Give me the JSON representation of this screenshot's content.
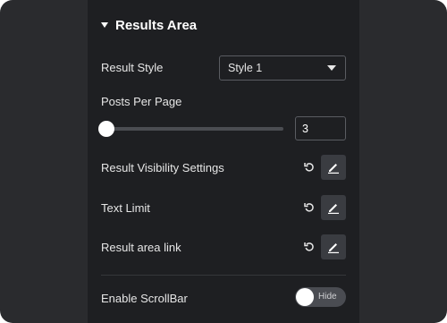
{
  "section": {
    "title": "Results Area",
    "caret_icon": "caret-down-icon"
  },
  "result_style": {
    "label": "Result Style",
    "selected": "Style 1",
    "dropdown_icon": "chevron-down-icon"
  },
  "posts_per_page": {
    "label": "Posts Per Page",
    "value": "3",
    "slider_min": 1,
    "slider_max": 100,
    "slider_value": 3
  },
  "rows": [
    {
      "label": "Result Visibility Settings",
      "reset_icon": "reset-icon",
      "edit_icon": "pencil-icon"
    },
    {
      "label": "Text Limit",
      "reset_icon": "reset-icon",
      "edit_icon": "pencil-icon"
    },
    {
      "label": "Result area link",
      "reset_icon": "reset-icon",
      "edit_icon": "pencil-icon"
    }
  ],
  "scrollbar": {
    "label": "Enable ScrollBar",
    "toggle_text": "Hide",
    "state": "off"
  },
  "colors": {
    "panel_bg": "#1e1f22",
    "outer_bg": "#2a2b2e",
    "text": "#e6e6e6",
    "accent_button": "#3a3c41"
  }
}
